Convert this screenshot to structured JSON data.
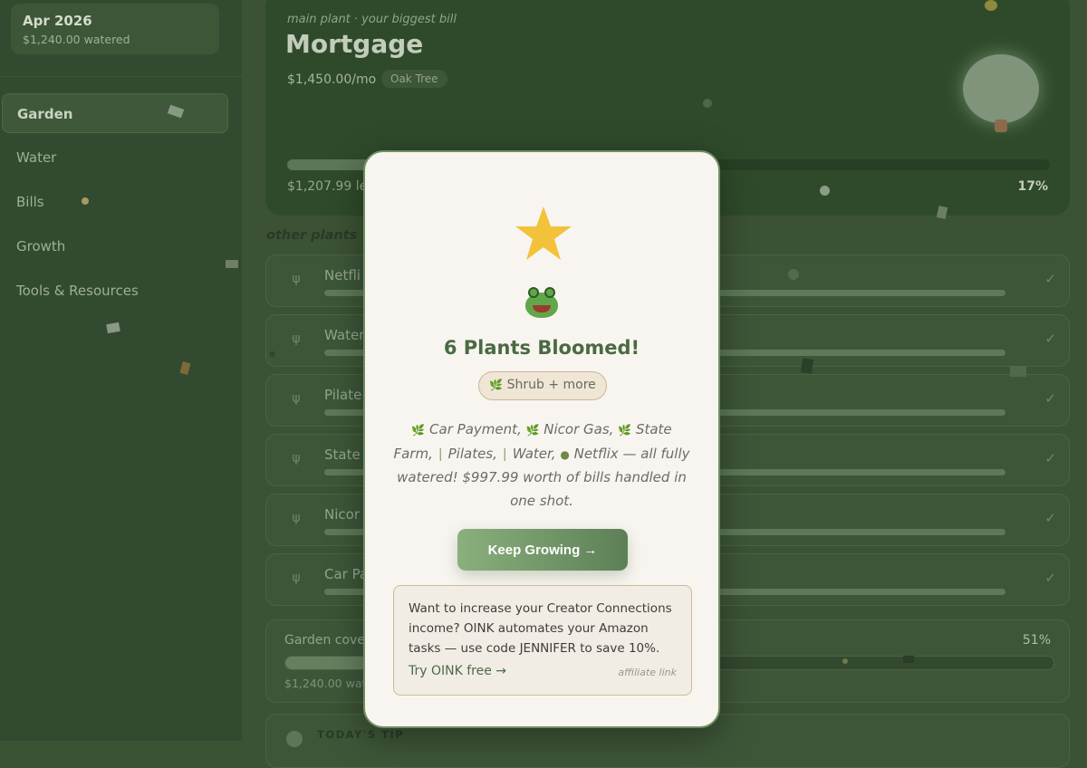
{
  "sidebar": {
    "month": {
      "title": "Apr 2026",
      "subtitle": "$1,240.00 watered"
    },
    "nav": [
      {
        "label": "Garden",
        "active": true
      },
      {
        "label": "Water"
      },
      {
        "label": "Bills"
      },
      {
        "label": "Growth"
      },
      {
        "label": "Tools & Resources"
      }
    ]
  },
  "hero": {
    "kicker": "main plant · your biggest bill",
    "title": "Mortgage",
    "amount": "$1,450.00/mo",
    "badge": "Oak Tree",
    "progress_percent": 17,
    "remaining": "$1,207.99 le",
    "percent_label": "17%"
  },
  "other_plants": {
    "heading": "other plants",
    "items": [
      {
        "name": "Netfli",
        "icon": "sprout-icon"
      },
      {
        "name": "Water",
        "icon": "sprout-icon"
      },
      {
        "name": "Pilate",
        "icon": "sprout-icon"
      },
      {
        "name": "State",
        "icon": "sprout-icon"
      },
      {
        "name": "Nicor",
        "icon": "sprout-icon"
      },
      {
        "name": "Car Pa",
        "icon": "sprout-icon"
      }
    ]
  },
  "coverage": {
    "label": "Garden cover",
    "percent_label": "51%",
    "progress_percent": 51,
    "sub": "$1,240.00 wat"
  },
  "tip": {
    "label": "TODAY'S TIP"
  },
  "modal": {
    "emoji": "frog",
    "title": "6 Plants Bloomed!",
    "badge": "Shrub + more",
    "desc_plants": [
      "Car Payment,",
      "Nicor Gas,",
      "State Farm,",
      "Pilates,",
      "Water,",
      "Netflix"
    ],
    "desc_tail": " — all fully watered! $997.99 worth of bills handled in one shot.",
    "button": "Keep Growing →",
    "affiliate": {
      "text": "Want to increase your Creator Connections income? OINK automates your Amazon tasks — use code JENNIFER to save 10%.",
      "link": "Try OINK free →",
      "tag": "affiliate link"
    }
  },
  "colors": {
    "accent": "#4a6a42",
    "star": "#f2c23a",
    "overlay": "#3b5234"
  }
}
